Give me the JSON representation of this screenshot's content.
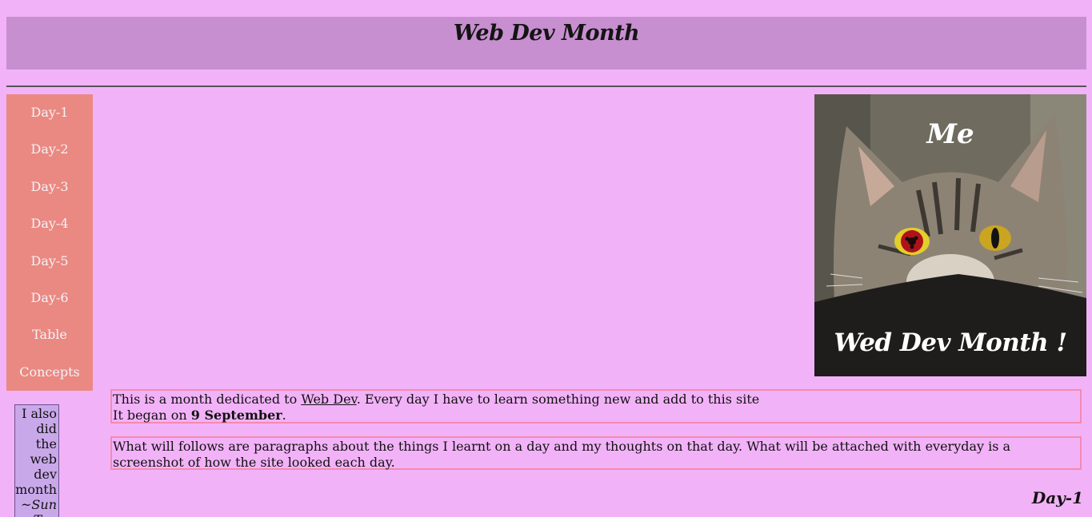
{
  "header": {
    "title": "Web Dev Month"
  },
  "sidebar": {
    "items": [
      {
        "label": "Day-1"
      },
      {
        "label": "Day-2"
      },
      {
        "label": "Day-3"
      },
      {
        "label": "Day-4"
      },
      {
        "label": "Day-5"
      },
      {
        "label": "Day-6"
      },
      {
        "label": "Table"
      },
      {
        "label": "Concepts"
      }
    ]
  },
  "hero": {
    "caption_top": "Me",
    "caption_bottom": "Wed Dev Month !",
    "image": "cat-photo"
  },
  "aside": {
    "text": "I also did the web dev month",
    "signature": "~Sun Tzu"
  },
  "intro": {
    "p1_before_link": "This is a month dedicated to ",
    "p1_link": "Web Dev",
    "p1_after_link": ". Every day I have to learn something new and add to this site",
    "p1_line2_before": "It began on ",
    "p1_line2_bold": "9 September",
    "p1_line2_after": ".",
    "p2": "What will follows are paragraphs about the things I learnt on a day and my thoughts on that day. What will be attached with everyday is a screenshot of how the site looked each day."
  },
  "day_heading": "Day-1",
  "colors": {
    "background": "#f2b2f8",
    "header": "#c88fd0",
    "sidebar": "#e98982",
    "paragraph_border": "#f48ab0"
  }
}
